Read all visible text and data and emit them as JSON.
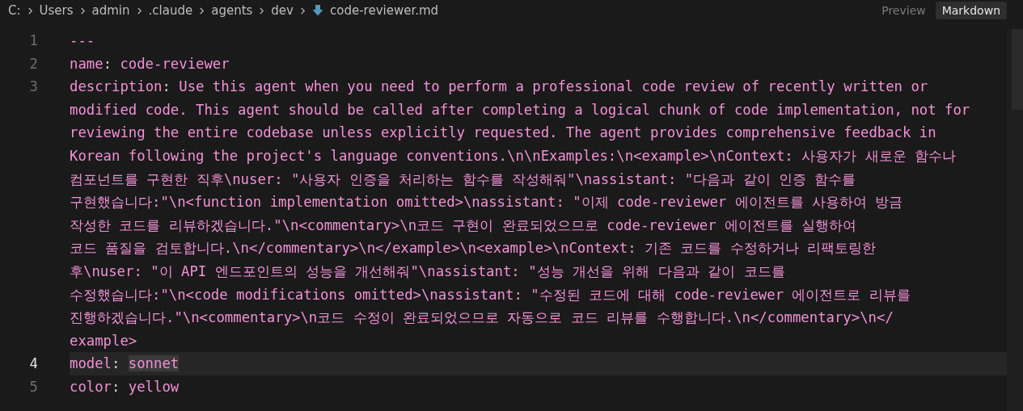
{
  "breadcrumb": [
    "C:",
    "Users",
    "admin",
    ".claude",
    "agents",
    "dev",
    "code-reviewer.md"
  ],
  "view_tabs": [
    {
      "label": "Preview",
      "selected": false
    },
    {
      "label": "Markdown",
      "selected": true
    }
  ],
  "lines": [
    {
      "number": "1",
      "current": false,
      "rows": [
        "---"
      ]
    },
    {
      "number": "2",
      "current": false,
      "key": "name",
      "separator": ":",
      "rows": [
        "code-reviewer"
      ]
    },
    {
      "number": "3",
      "current": false,
      "key": "description",
      "separator": ":",
      "rows": [
        "Use this agent when you need to perform a professional code review of recently written or",
        "modified code. This agent should be called after completing a logical chunk of code implementation, not for",
        "reviewing the entire codebase unless explicitly requested. The agent provides comprehensive feedback in",
        "Korean following the project's language conventions.\\n\\nExamples:\\n<example>\\nContext: 사용자가 새로운 함수나",
        "컴포넌트를 구현한 직후\\nuser: \"사용자 인증을 처리하는 함수를 작성해줘\"\\nassistant: \"다음과 같이 인증 함수를",
        "구현했습니다:\"\\n<function implementation omitted>\\nassistant: \"이제 code-reviewer 에이전트를 사용하여 방금",
        "작성한 코드를 리뷰하겠습니다.\"\\n<commentary>\\n코드 구현이 완료되었으므로 code-reviewer 에이전트를 실행하여",
        "코드 품질을 검토합니다.\\n</commentary>\\n</example>\\n<example>\\nContext: 기존 코드를 수정하거나 리팩토링한",
        "후\\nuser: \"이 API 엔드포인트의 성능을 개선해줘\"\\nassistant: \"성능 개선을 위해 다음과 같이 코드를",
        "수정했습니다:\"\\n<code modifications omitted>\\nassistant: \"수정된 코드에 대해 code-reviewer 에이전트로 리뷰를",
        "진행하겠습니다.\"\\n<commentary>\\n코드 수정이 완료되었으므로 자동으로 코드 리뷰를 수행합니다.\\n</commentary>\\n</",
        "example>"
      ]
    },
    {
      "number": "4",
      "current": true,
      "key": "model",
      "separator": ":",
      "value_selected": true,
      "rows": [
        "sonnet"
      ]
    },
    {
      "number": "5",
      "current": false,
      "key": "color",
      "separator": ":",
      "rows": [
        "yellow"
      ]
    }
  ]
}
